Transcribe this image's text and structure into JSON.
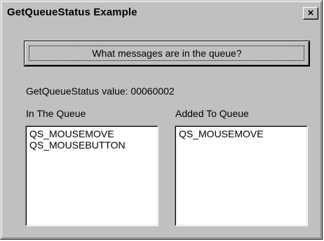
{
  "window": {
    "title": "GetQueueStatus Example",
    "close_glyph": "×"
  },
  "action_button": {
    "label": "What messages are in the queue?"
  },
  "status": {
    "text": "GetQueueStatus value: 00060002"
  },
  "lists": {
    "in_queue": {
      "caption": "In The Queue",
      "items": [
        "QS_MOUSEMOVE",
        "QS_MOUSEBUTTON"
      ]
    },
    "added": {
      "caption": "Added To Queue",
      "items": [
        "QS_MOUSEMOVE"
      ]
    }
  },
  "colors": {
    "face": "#c0c0c0",
    "window_bg": "#ffffff",
    "text": "#000000"
  }
}
